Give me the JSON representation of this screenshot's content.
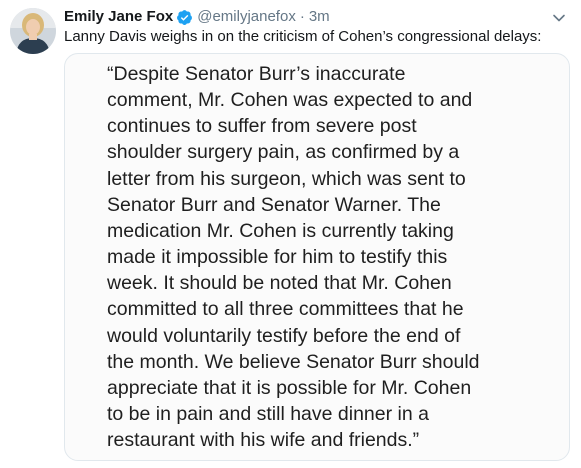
{
  "tweet": {
    "author_name": "Emily Jane Fox",
    "handle": "@emilyjanefox",
    "separator": "·",
    "time": "3m",
    "text": "Lanny Davis weighs in on the criticism of Cohen’s congressional delays:",
    "verified_icon": "verified-badge",
    "menu_icon": "chevron-down",
    "verified_color": "#1da1f2"
  },
  "quote_image": {
    "lines": [
      "“Despite Senator Burr’s inaccurate",
      "comment, Mr. Cohen was expected to and",
      "continues to suffer from severe post",
      "shoulder surgery pain, as confirmed by a",
      "letter from his surgeon, which was sent to",
      "Senator Burr and Senator Warner. The",
      "medication Mr. Cohen is currently taking",
      "made it impossible for him to testify this",
      "week. It should be noted that Mr. Cohen",
      "committed to all three committees that he",
      "would voluntarily testify before the end of",
      "the month. We believe Senator Burr should",
      "appreciate that it is possible for Mr. Cohen",
      "to be in pain and still have dinner in a",
      "restaurant with his wife and friends.”"
    ]
  }
}
